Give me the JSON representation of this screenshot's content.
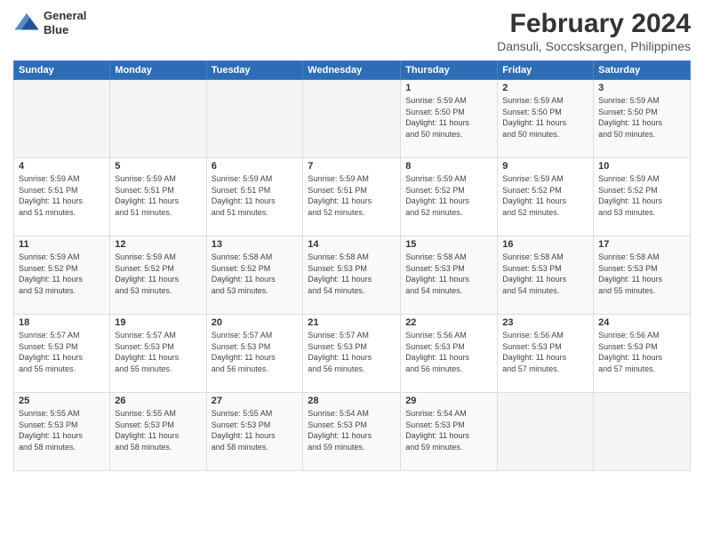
{
  "logo": {
    "line1": "General",
    "line2": "Blue"
  },
  "title": "February 2024",
  "subtitle": "Dansuli, Soccsksargen, Philippines",
  "weekdays": [
    "Sunday",
    "Monday",
    "Tuesday",
    "Wednesday",
    "Thursday",
    "Friday",
    "Saturday"
  ],
  "weeks": [
    [
      {
        "day": "",
        "info": ""
      },
      {
        "day": "",
        "info": ""
      },
      {
        "day": "",
        "info": ""
      },
      {
        "day": "",
        "info": ""
      },
      {
        "day": "1",
        "info": "Sunrise: 5:59 AM\nSunset: 5:50 PM\nDaylight: 11 hours\nand 50 minutes."
      },
      {
        "day": "2",
        "info": "Sunrise: 5:59 AM\nSunset: 5:50 PM\nDaylight: 11 hours\nand 50 minutes."
      },
      {
        "day": "3",
        "info": "Sunrise: 5:59 AM\nSunset: 5:50 PM\nDaylight: 11 hours\nand 50 minutes."
      }
    ],
    [
      {
        "day": "4",
        "info": "Sunrise: 5:59 AM\nSunset: 5:51 PM\nDaylight: 11 hours\nand 51 minutes."
      },
      {
        "day": "5",
        "info": "Sunrise: 5:59 AM\nSunset: 5:51 PM\nDaylight: 11 hours\nand 51 minutes."
      },
      {
        "day": "6",
        "info": "Sunrise: 5:59 AM\nSunset: 5:51 PM\nDaylight: 11 hours\nand 51 minutes."
      },
      {
        "day": "7",
        "info": "Sunrise: 5:59 AM\nSunset: 5:51 PM\nDaylight: 11 hours\nand 52 minutes."
      },
      {
        "day": "8",
        "info": "Sunrise: 5:59 AM\nSunset: 5:52 PM\nDaylight: 11 hours\nand 52 minutes."
      },
      {
        "day": "9",
        "info": "Sunrise: 5:59 AM\nSunset: 5:52 PM\nDaylight: 11 hours\nand 52 minutes."
      },
      {
        "day": "10",
        "info": "Sunrise: 5:59 AM\nSunset: 5:52 PM\nDaylight: 11 hours\nand 53 minutes."
      }
    ],
    [
      {
        "day": "11",
        "info": "Sunrise: 5:59 AM\nSunset: 5:52 PM\nDaylight: 11 hours\nand 53 minutes."
      },
      {
        "day": "12",
        "info": "Sunrise: 5:59 AM\nSunset: 5:52 PM\nDaylight: 11 hours\nand 53 minutes."
      },
      {
        "day": "13",
        "info": "Sunrise: 5:58 AM\nSunset: 5:52 PM\nDaylight: 11 hours\nand 53 minutes."
      },
      {
        "day": "14",
        "info": "Sunrise: 5:58 AM\nSunset: 5:53 PM\nDaylight: 11 hours\nand 54 minutes."
      },
      {
        "day": "15",
        "info": "Sunrise: 5:58 AM\nSunset: 5:53 PM\nDaylight: 11 hours\nand 54 minutes."
      },
      {
        "day": "16",
        "info": "Sunrise: 5:58 AM\nSunset: 5:53 PM\nDaylight: 11 hours\nand 54 minutes."
      },
      {
        "day": "17",
        "info": "Sunrise: 5:58 AM\nSunset: 5:53 PM\nDaylight: 11 hours\nand 55 minutes."
      }
    ],
    [
      {
        "day": "18",
        "info": "Sunrise: 5:57 AM\nSunset: 5:53 PM\nDaylight: 11 hours\nand 55 minutes."
      },
      {
        "day": "19",
        "info": "Sunrise: 5:57 AM\nSunset: 5:53 PM\nDaylight: 11 hours\nand 55 minutes."
      },
      {
        "day": "20",
        "info": "Sunrise: 5:57 AM\nSunset: 5:53 PM\nDaylight: 11 hours\nand 56 minutes."
      },
      {
        "day": "21",
        "info": "Sunrise: 5:57 AM\nSunset: 5:53 PM\nDaylight: 11 hours\nand 56 minutes."
      },
      {
        "day": "22",
        "info": "Sunrise: 5:56 AM\nSunset: 5:53 PM\nDaylight: 11 hours\nand 56 minutes."
      },
      {
        "day": "23",
        "info": "Sunrise: 5:56 AM\nSunset: 5:53 PM\nDaylight: 11 hours\nand 57 minutes."
      },
      {
        "day": "24",
        "info": "Sunrise: 5:56 AM\nSunset: 5:53 PM\nDaylight: 11 hours\nand 57 minutes."
      }
    ],
    [
      {
        "day": "25",
        "info": "Sunrise: 5:55 AM\nSunset: 5:53 PM\nDaylight: 11 hours\nand 58 minutes."
      },
      {
        "day": "26",
        "info": "Sunrise: 5:55 AM\nSunset: 5:53 PM\nDaylight: 11 hours\nand 58 minutes."
      },
      {
        "day": "27",
        "info": "Sunrise: 5:55 AM\nSunset: 5:53 PM\nDaylight: 11 hours\nand 58 minutes."
      },
      {
        "day": "28",
        "info": "Sunrise: 5:54 AM\nSunset: 5:53 PM\nDaylight: 11 hours\nand 59 minutes."
      },
      {
        "day": "29",
        "info": "Sunrise: 5:54 AM\nSunset: 5:53 PM\nDaylight: 11 hours\nand 59 minutes."
      },
      {
        "day": "",
        "info": ""
      },
      {
        "day": "",
        "info": ""
      }
    ]
  ]
}
